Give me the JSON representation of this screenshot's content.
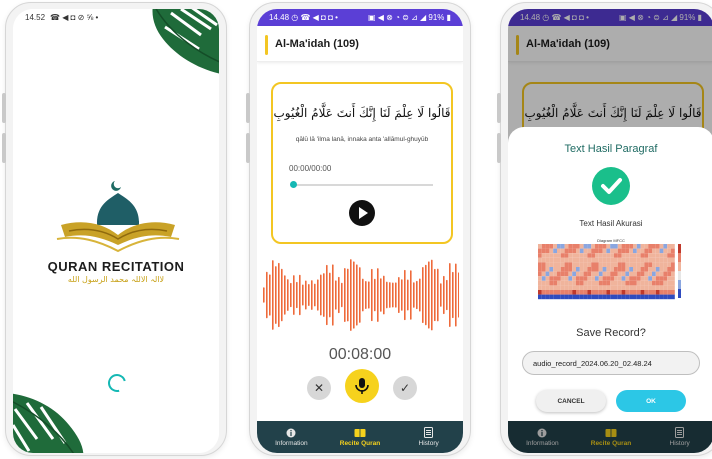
{
  "splash": {
    "status_time": "14.52",
    "status_icons": "☎ ◀ ◘ ⊘ ⅝ •",
    "brand": "QURAN RECITATION",
    "brand_sub": "لاالہ الاللہ محمد الرسول الله"
  },
  "recite": {
    "status_time": "14.48",
    "status_icons": "◷ ☎ ◀ ◘ ◘ •",
    "status_right": "▣ ◀ ⊗ ◔ ⊜ ⊿ ◢ 91% ▮",
    "surah_title": "Al-Ma'idah (109)",
    "arabic": "قَالُوا لَا عِلْمَ لَنَا إِنَّكَ أَنتَ عَلَّامُ الْغُيُوبِ",
    "transliteration": "qālū lā 'ilma lanā, innaka anta 'allāmul-ghuyūb",
    "elapsed": "00:00/00:00",
    "seek_progress": 0.0,
    "timer": "00:08:00",
    "cancel_glyph": "✕",
    "confirm_glyph": "✓"
  },
  "dialog": {
    "status_time": "14.48",
    "status_icons": "◷ ☎ ◀ ◘ ◘ •",
    "status_right": "▣ ◀ ⊗ ◔ ⊜ ⊿ ◢ 91% ▮",
    "background_title": "Al-Ma'idah (109)",
    "background_arabic": "قَالُوا لَا عِلْمَ لَنَا إِنَّكَ أَنتَ عَلَّامُ الْغُيُوبِ",
    "title": "Text Hasil Paragraf",
    "accuracy_label": "Text Hasil Akurasi",
    "spectrogram_title": "Diagram MFCC",
    "save_question": "Save Record?",
    "filename": "audio_record_2024.06.20_02.48.24",
    "cancel_label": "CANCEL",
    "ok_label": "OK"
  },
  "nav": [
    {
      "label": "Information",
      "icon": "info-icon"
    },
    {
      "label": "Recite Quran",
      "icon": "book-icon"
    },
    {
      "label": "History",
      "icon": "history-icon"
    }
  ],
  "colors": {
    "accent_yellow": "#f6d21d",
    "teal": "#15b8b4",
    "nav_bg": "#22414a",
    "success_green": "#1abf8b",
    "ok_blue": "#2cc7e6",
    "status_purple": "#5b3fd6",
    "waveform": "#ee6a3b"
  }
}
